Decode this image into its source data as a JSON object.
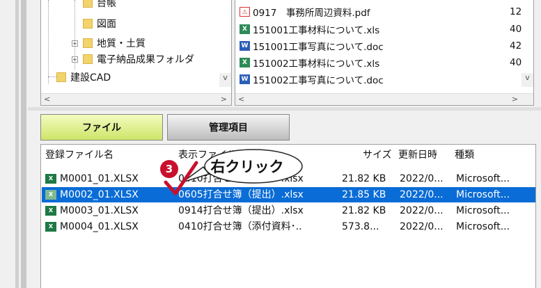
{
  "tree": {
    "items": [
      {
        "label": "台帳"
      },
      {
        "label": "図面"
      },
      {
        "label": "地質・土質"
      },
      {
        "label": "電子納品成果フォルダ"
      },
      {
        "label": "建設CAD"
      }
    ],
    "scroll_left": "<",
    "scroll_right": ">",
    "scroll_down": "v"
  },
  "files": {
    "items": [
      {
        "name": "0917　事務所周辺資料.pdf",
        "icon": "pdf-icon",
        "size": "12"
      },
      {
        "name": "151001工事材料について.xls",
        "icon": "xls-icon",
        "size": "40"
      },
      {
        "name": "151001工事写真について.doc",
        "icon": "doc-icon",
        "size": "42"
      },
      {
        "name": "151002工事材料について.xls",
        "icon": "xls-icon",
        "size": "40"
      },
      {
        "name": "151002工事写真について.doc",
        "icon": "doc-icon",
        "size": ""
      }
    ],
    "scroll_left": "<",
    "scroll_right": ">",
    "scroll_down": "v"
  },
  "tabs": [
    {
      "label": "ファイル",
      "active": true
    },
    {
      "label": "管理項目",
      "active": false
    }
  ],
  "registered": {
    "headers": [
      "登録ファイル名",
      "表示ファイル名",
      "サイズ",
      "更新日時",
      "種類"
    ],
    "rows": [
      {
        "file": "M0001_01.XLSX",
        "display": "0410打合せ簿（提出）.xlsx",
        "size": "21.82 KB",
        "date": "2022/0...",
        "type": "Microsoft...",
        "selected": false
      },
      {
        "file": "M0002_01.XLSX",
        "display": "0605打合せ簿（提出）.xlsx",
        "size": "21.85 KB",
        "date": "2022/0...",
        "type": "Microsoft...",
        "selected": true
      },
      {
        "file": "M0003_01.XLSX",
        "display": "0914打合せ簿（提出）.xlsx",
        "size": "21.82 KB",
        "date": "2022/0...",
        "type": "Microsoft...",
        "selected": false
      },
      {
        "file": "M0004_01.XLSX",
        "display": "0410打合せ簿（添付資料･..",
        "size": "573.8...",
        "date": "2022/0...",
        "type": "Microsoft...",
        "selected": false
      }
    ]
  },
  "annotation": {
    "step": "3",
    "callout": "右クリック",
    "colors": {
      "badge": "#c8102e",
      "check": "#c8102e"
    }
  },
  "colors": {
    "selection": "#0a6cd6",
    "tab_active": "#cde569"
  }
}
